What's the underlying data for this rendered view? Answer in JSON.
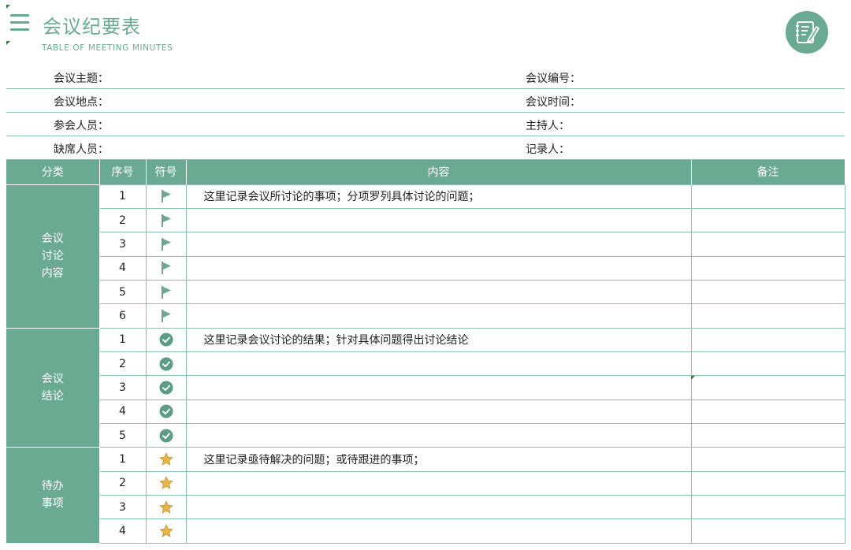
{
  "header": {
    "title": "会议纪要表",
    "subtitle": "TABLE OF MEETING MINUTES"
  },
  "info": [
    {
      "left": "会议主题：",
      "right": "会议编号："
    },
    {
      "left": "会议地点：",
      "right": "会议时间："
    },
    {
      "left": "参会人员：",
      "right": "主持人："
    },
    {
      "left": "缺席人员：",
      "right": "记录人："
    }
  ],
  "table": {
    "headers": [
      "分类",
      "序号",
      "符号",
      "内容",
      "备注"
    ],
    "groups": [
      {
        "category": "会议讨论内容",
        "icon": "flag-icon",
        "rows": [
          {
            "num": "1",
            "content": "这里记录会议所讨论的事项；分项罗列具体讨论的问题；",
            "note": ""
          },
          {
            "num": "2",
            "content": "",
            "note": ""
          },
          {
            "num": "3",
            "content": "",
            "note": ""
          },
          {
            "num": "4",
            "content": "",
            "note": ""
          },
          {
            "num": "5",
            "content": "",
            "note": ""
          },
          {
            "num": "6",
            "content": "",
            "note": ""
          }
        ]
      },
      {
        "category": "会议结论",
        "icon": "check-circle-icon",
        "rows": [
          {
            "num": "1",
            "content": "这里记录会议讨论的结果；针对具体问题得出讨论结论",
            "note": ""
          },
          {
            "num": "2",
            "content": "",
            "note": ""
          },
          {
            "num": "3",
            "content": "",
            "note": ""
          },
          {
            "num": "4",
            "content": "",
            "note": ""
          },
          {
            "num": "5",
            "content": "",
            "note": ""
          }
        ]
      },
      {
        "category": "待办事项",
        "icon": "star-icon",
        "rows": [
          {
            "num": "1",
            "content": "这里记录亟待解决的问题；或待跟进的事项；",
            "note": ""
          },
          {
            "num": "2",
            "content": "",
            "note": ""
          },
          {
            "num": "3",
            "content": "",
            "note": ""
          },
          {
            "num": "4",
            "content": "",
            "note": ""
          }
        ]
      }
    ]
  },
  "colors": {
    "accent": "#6aaa92",
    "border": "#8fbfae",
    "star": "#e8b54a",
    "check": "#5c9c84"
  }
}
